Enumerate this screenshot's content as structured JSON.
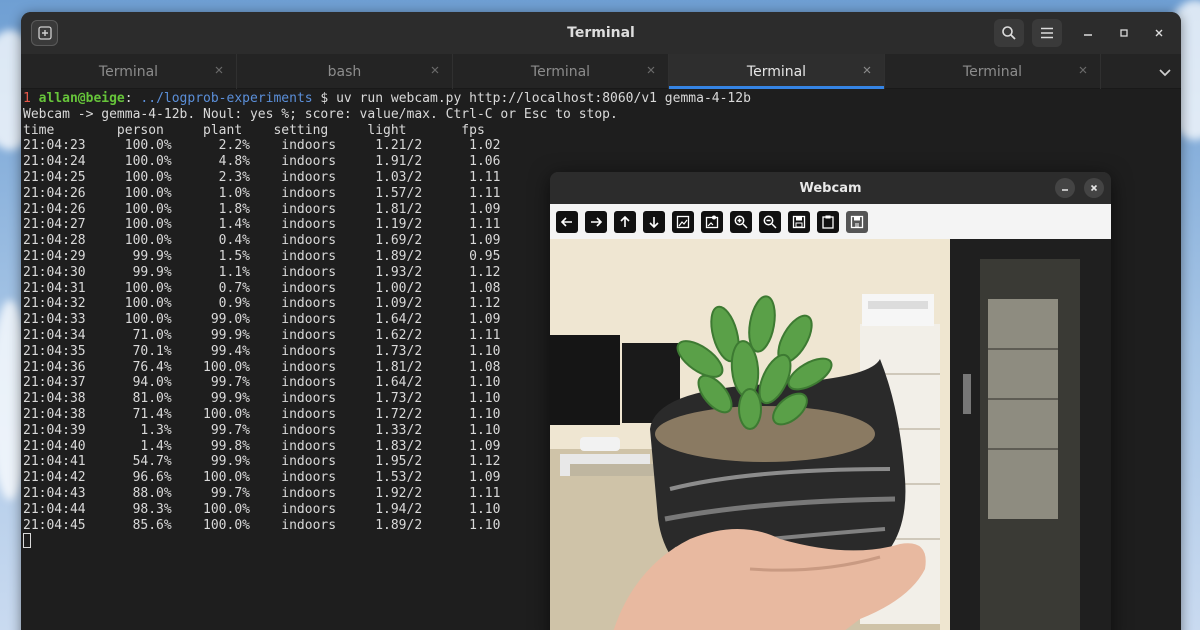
{
  "window": {
    "title": "Terminal",
    "tabs": [
      {
        "label": "Terminal",
        "active": false
      },
      {
        "label": "bash",
        "active": false
      },
      {
        "label": "Terminal",
        "active": false
      },
      {
        "label": "Terminal",
        "active": true
      },
      {
        "label": "Terminal",
        "active": false
      }
    ]
  },
  "terminal": {
    "prompt_index": "1",
    "prompt_user": "allan",
    "prompt_at": "@",
    "prompt_host": "beige",
    "prompt_colon": ":",
    "prompt_path": " ../logprob-experiments",
    "prompt_symbol": " $",
    "command": " uv run webcam.py http://localhost:8060/v1 gemma-4-12b",
    "info_line": "Webcam -> gemma-4-12b. Noul: yes %; score: value/max. Ctrl-C or Esc to stop.",
    "header_line": "time        person     plant    setting     light       fps",
    "rows": [
      "21:04:23     100.0%      2.2%    indoors     1.21/2      1.02",
      "21:04:24     100.0%      4.8%    indoors     1.91/2      1.06",
      "21:04:25     100.0%      2.3%    indoors     1.03/2      1.11",
      "21:04:26     100.0%      1.0%    indoors     1.57/2      1.11",
      "21:04:26     100.0%      1.8%    indoors     1.81/2      1.09",
      "21:04:27     100.0%      1.4%    indoors     1.19/2      1.11",
      "21:04:28     100.0%      0.4%    indoors     1.69/2      1.09",
      "21:04:29      99.9%      1.5%    indoors     1.89/2      0.95",
      "21:04:30      99.9%      1.1%    indoors     1.93/2      1.12",
      "21:04:31     100.0%      0.7%    indoors     1.00/2      1.08",
      "21:04:32     100.0%      0.9%    indoors     1.09/2      1.12",
      "21:04:33     100.0%     99.0%    indoors     1.64/2      1.09",
      "21:04:34      71.0%     99.9%    indoors     1.62/2      1.11",
      "21:04:35      70.1%     99.4%    indoors     1.73/2      1.10",
      "21:04:36      76.4%    100.0%    indoors     1.81/2      1.08",
      "21:04:37      94.0%     99.7%    indoors     1.64/2      1.10",
      "21:04:38      81.0%     99.9%    indoors     1.73/2      1.10",
      "21:04:38      71.4%    100.0%    indoors     1.72/2      1.10",
      "21:04:39       1.3%     99.7%    indoors     1.33/2      1.10",
      "21:04:40       1.4%     99.8%    indoors     1.83/2      1.09",
      "21:04:41      54.7%     99.9%    indoors     1.95/2      1.12",
      "21:04:42      96.6%    100.0%    indoors     1.53/2      1.09",
      "21:04:43      88.0%     99.7%    indoors     1.92/2      1.11",
      "21:04:44      98.3%    100.0%    indoors     1.94/2      1.10",
      "21:04:45      85.6%    100.0%    indoors     1.89/2      1.10"
    ]
  },
  "webcam": {
    "title": "Webcam",
    "toolbar_icons": [
      "arrow-left-icon",
      "arrow-right-icon",
      "arrow-up-icon",
      "arrow-down-icon",
      "home-icon",
      "configure-icon",
      "zoom-in-icon",
      "zoom-out-icon",
      "save-icon",
      "clipboard-icon",
      "save-as-icon"
    ]
  },
  "colors": {
    "accent": "#3584e4",
    "prompt_red": "#e6574a",
    "prompt_green": "#66c43a",
    "prompt_blue": "#5b8fd9"
  }
}
